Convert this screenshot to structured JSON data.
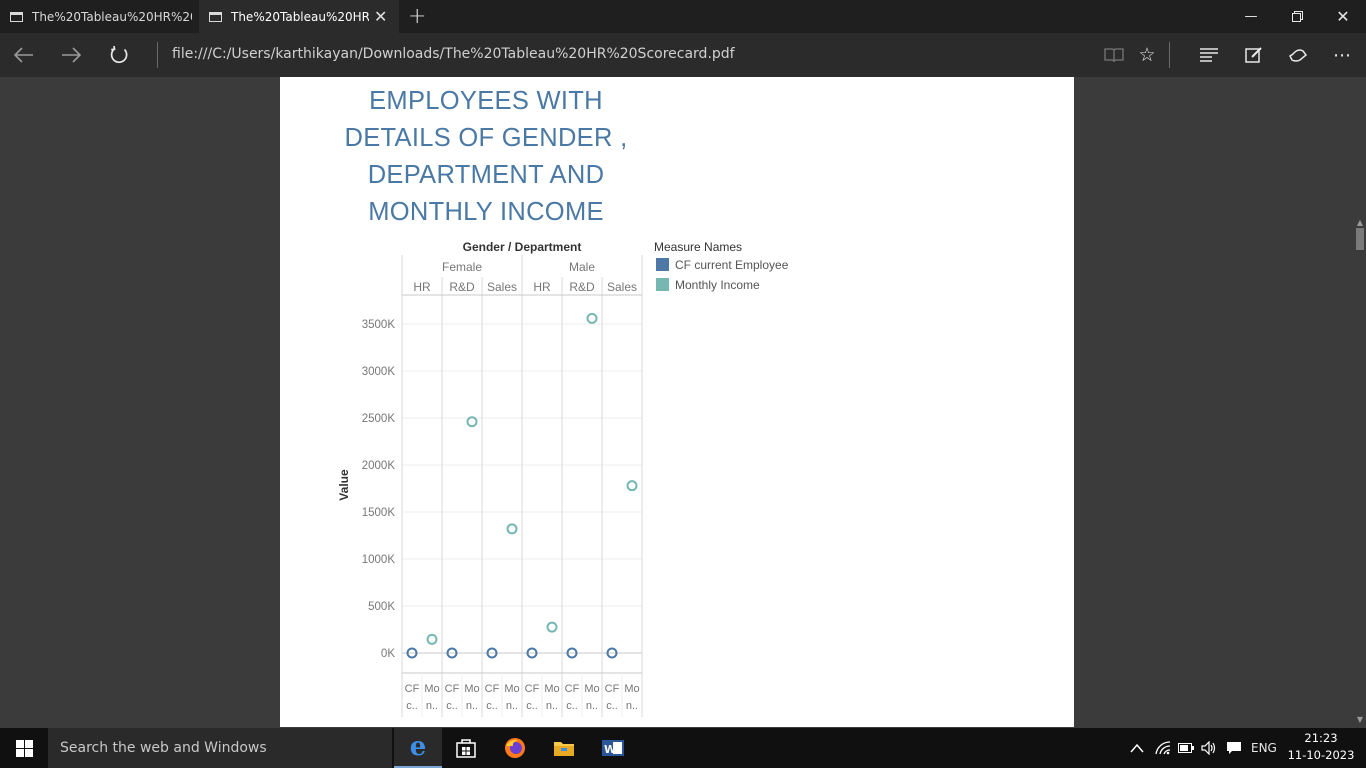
{
  "browser": {
    "tabs": [
      {
        "title": "The%20Tableau%20HR%20Sc",
        "active": false
      },
      {
        "title": "The%20Tableau%20HR%",
        "active": true
      }
    ],
    "address": "file:///C:/Users/karthikayan/Downloads/The%20Tableau%20HR%20Scorecard.pdf",
    "window_controls": [
      "minimize",
      "restore",
      "close"
    ],
    "toolbar_icons": [
      "reading-view-icon",
      "favorite-star-icon",
      "hub-icon",
      "web-note-icon",
      "share-icon",
      "more-icon"
    ]
  },
  "document": {
    "title_lines": [
      "EMPLOYEES WITH",
      "DETAILS OF GENDER ,",
      "DEPARTMENT AND",
      "MONTHLY INCOME"
    ]
  },
  "chart_data": {
    "type": "scatter",
    "column_header_title": "Gender / Department",
    "genders": [
      "Female",
      "Male"
    ],
    "departments": [
      "HR",
      "R&D",
      "Sales",
      "HR",
      "R&D",
      "Sales"
    ],
    "measure_tick_labels": [
      [
        "CF",
        "c.."
      ],
      [
        "Mo",
        "n.."
      ]
    ],
    "ylabel": "Value",
    "ylim": [
      0,
      3500
    ],
    "y_unit_suffix": "K",
    "yticks": [
      0,
      500,
      1000,
      1500,
      2000,
      2500,
      3000,
      3500
    ],
    "grid": true,
    "legend_title": "Measure Names",
    "legend_position": "top-right",
    "series": [
      {
        "name": "CF current Employee",
        "color": "#4e79a7",
        "values": [
          0,
          0,
          0,
          0,
          0,
          0
        ]
      },
      {
        "name": "Monthly Income",
        "color": "#76b7b2",
        "values": [
          145,
          2460,
          1320,
          275,
          3560,
          1780
        ]
      }
    ]
  },
  "taskbar": {
    "search_placeholder": "Search the web and Windows",
    "apps": [
      "edge-icon",
      "store-icon",
      "firefox-icon",
      "file-explorer-icon",
      "word-icon"
    ],
    "language": "ENG",
    "time": "21:23",
    "date": "11-10-2023"
  }
}
